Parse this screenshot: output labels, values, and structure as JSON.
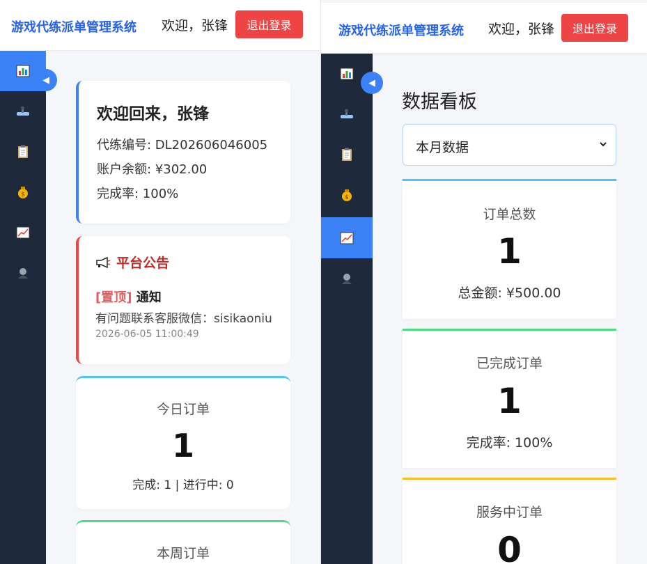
{
  "app": {
    "title": "游戏代练派单管理系统",
    "welcome": "欢迎，张锋",
    "logout_label": "退出登录"
  },
  "sidebar": {
    "items": [
      {
        "icon": "chart-icon",
        "active_left": true,
        "active_right": false
      },
      {
        "icon": "game-controller-icon",
        "active_left": false,
        "active_right": false
      },
      {
        "icon": "clipboard-icon",
        "active_left": false,
        "active_right": false
      },
      {
        "icon": "money-bag-icon",
        "active_left": false,
        "active_right": false
      },
      {
        "icon": "trend-chart-icon",
        "active_left": false,
        "active_right": true
      },
      {
        "icon": "user-icon",
        "active_left": false,
        "active_right": false
      }
    ],
    "collapse_glyph": "◀"
  },
  "home": {
    "welcome_back": "欢迎回来，张锋",
    "booster_id": "代练编号: DL202606046005",
    "balance": "账户余额: ¥302.00",
    "completion": "完成率: 100%",
    "notice": {
      "title": "平台公告",
      "pin_tag": "[置顶]",
      "item_title": "通知",
      "content": "有问题联系客服微信：sisikaoniu",
      "time": "2026-06-05 11:00:49"
    },
    "today": {
      "title": "今日订单",
      "value": "1",
      "sub": "完成: 1 | 进行中: 0"
    },
    "week": {
      "title": "本周订单"
    }
  },
  "dashboard": {
    "title": "数据看板",
    "period_selected": "本月数据",
    "total": {
      "title": "订单总数",
      "value": "1",
      "sub": "总金额: ¥500.00"
    },
    "completed": {
      "title": "已完成订单",
      "value": "1",
      "sub": "完成率: 100%"
    },
    "in_service": {
      "title": "服务中订单",
      "value": "0"
    }
  },
  "colors": {
    "brand": "#2563eb",
    "sidebar_bg": "#1e293b",
    "active": "#3b82f6",
    "danger": "#ef4444"
  }
}
